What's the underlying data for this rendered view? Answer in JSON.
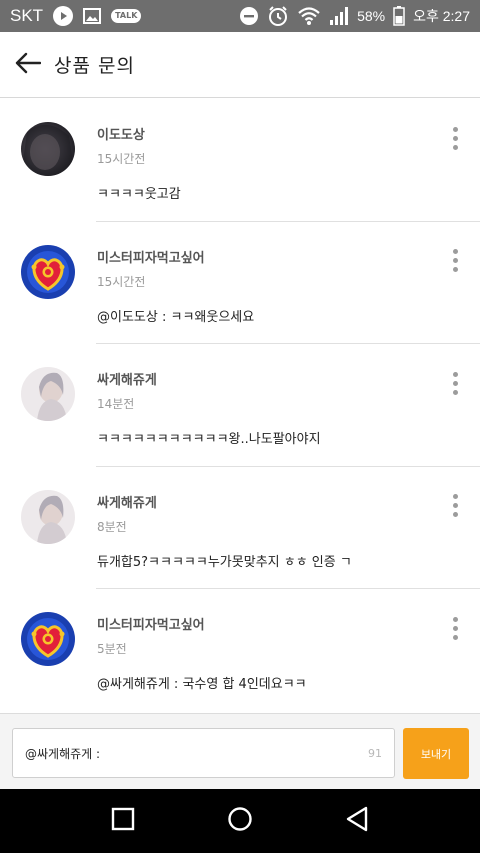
{
  "status_bar": {
    "carrier": "SKT",
    "battery": "58%",
    "time": "오후 2:27",
    "talk_label": "TALK",
    "icons": [
      "play-icon",
      "image-icon",
      "talk-icon",
      "minus-circle-icon",
      "alarm-icon",
      "wifi-icon",
      "signal-icon",
      "battery-icon"
    ]
  },
  "header": {
    "title": "상품 문의",
    "back_icon": "arrow-left-icon"
  },
  "comments": [
    {
      "author": "이도도상",
      "time": "15시간전",
      "text": "ㅋㅋㅋㅋ웃고감",
      "avatar": "photo-dark"
    },
    {
      "author": "미스터피자먹고싶어",
      "time": "15시간전",
      "text": "@이도도상 : ㅋㅋ왜웃으세요",
      "avatar": "sailor-moon-brooch"
    },
    {
      "author": "싸게해쥬게",
      "time": "14분전",
      "text": "ㅋㅋㅋㅋㅋㅋㅋㅋㅋㅋㅋ왕..나도팔아야지",
      "avatar": "photo-light"
    },
    {
      "author": "싸게해쥬게",
      "time": "8분전",
      "text": "듀개합5?ㅋㅋㅋㅋㅋ누가못맞추지 ㅎㅎ 인증 ㄱ",
      "avatar": "photo-light"
    },
    {
      "author": "미스터피자먹고싶어",
      "time": "5분전",
      "text": "@싸게해쥬게 : 국수영 합 4인데요ㅋㅋ",
      "avatar": "sailor-moon-brooch"
    }
  ],
  "input": {
    "value": "@싸게해쥬게 :",
    "char_count": "91",
    "send_label": "보내기"
  },
  "colors": {
    "accent": "#f6a11a",
    "status_bar": "#6e6e6e",
    "nav_bar": "#000000"
  }
}
